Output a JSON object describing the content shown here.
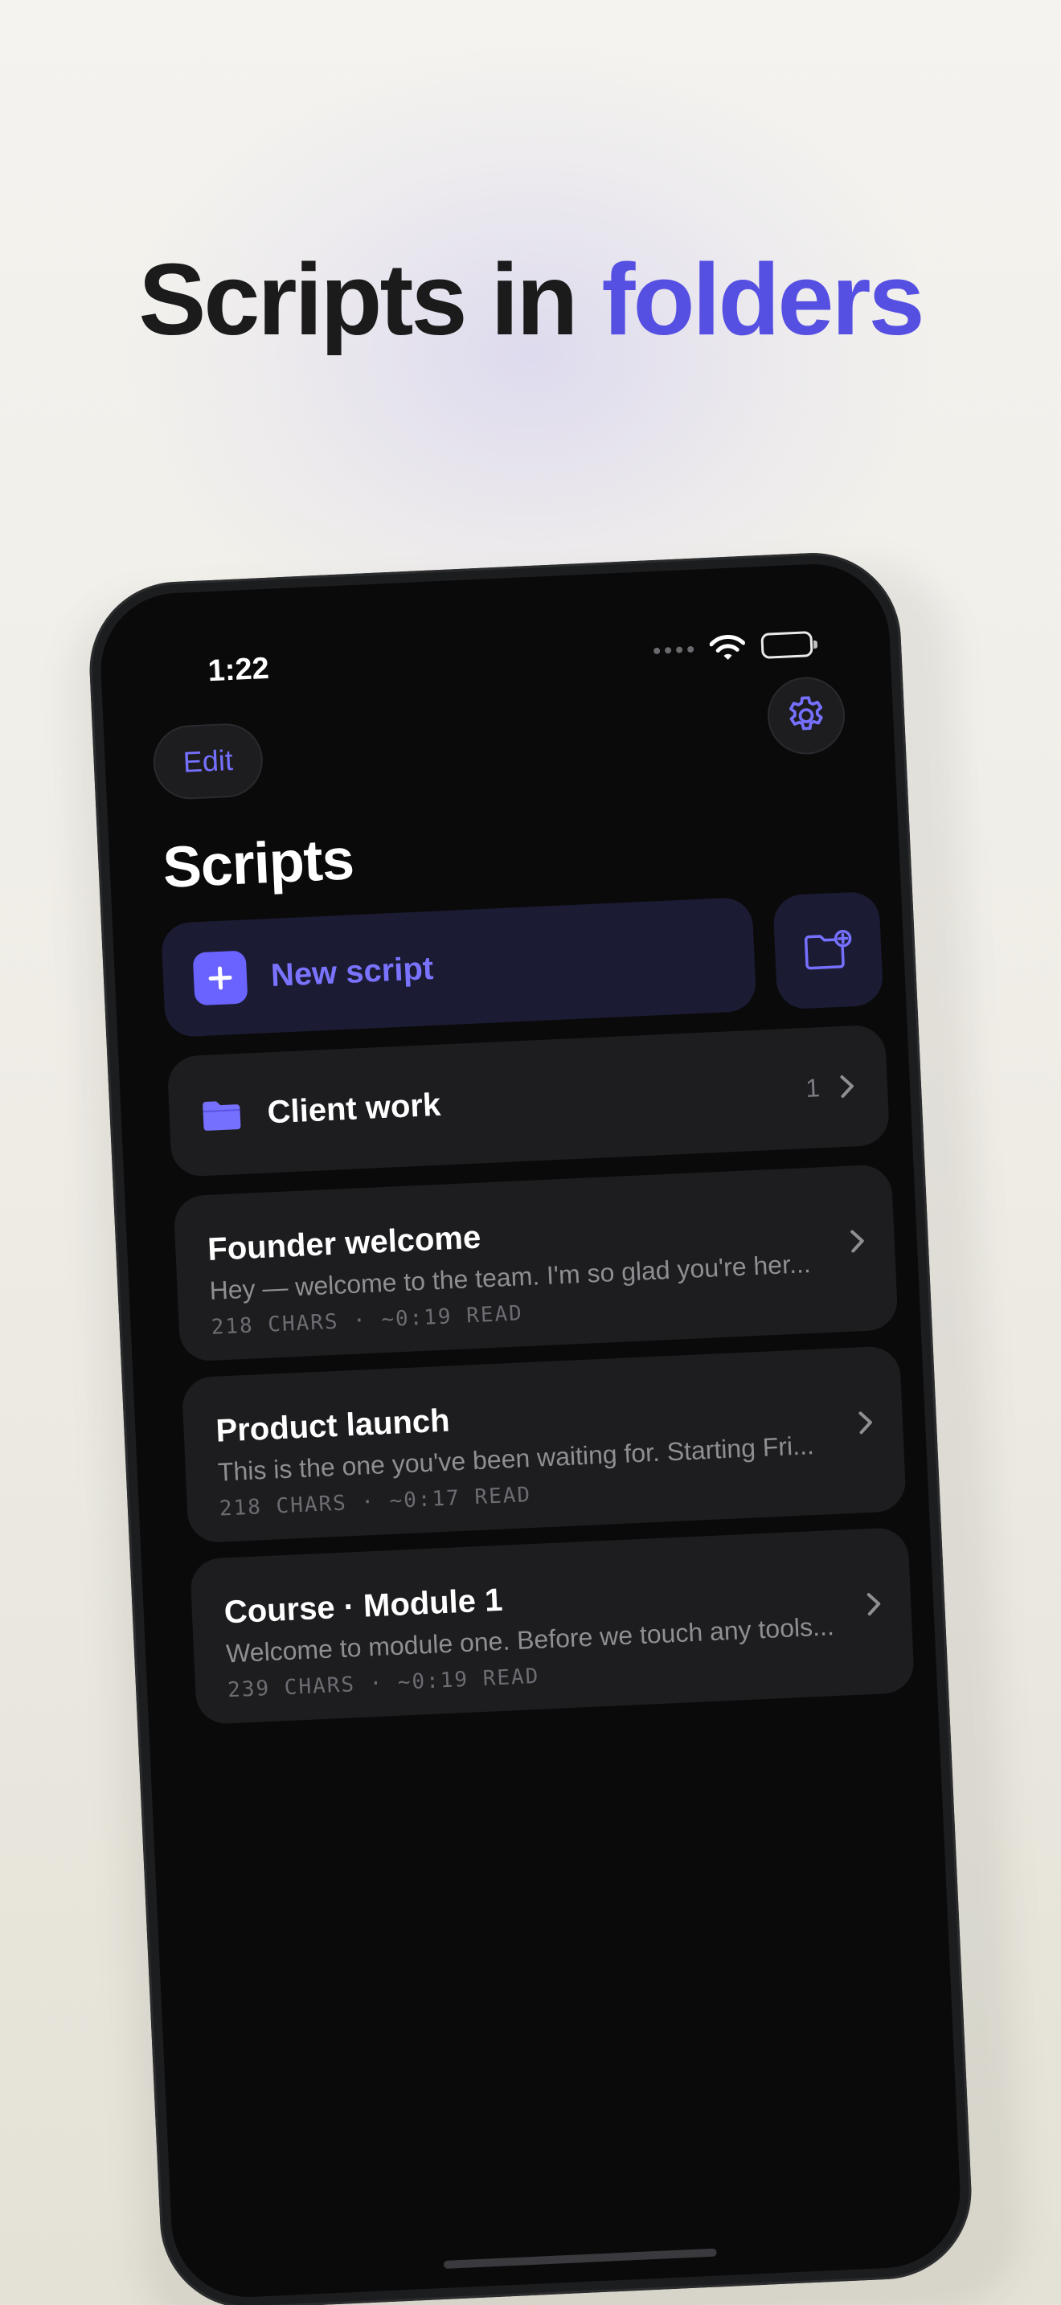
{
  "headline": {
    "part1": "Scripts in ",
    "accent": "folders"
  },
  "colors": {
    "accent": "#5650e2",
    "app_accent": "#6a63ff",
    "background": "#0a0a0b"
  },
  "status_bar": {
    "time": "1:22",
    "icons": [
      "signal-icon",
      "wifi-icon",
      "battery-icon"
    ]
  },
  "toolbar": {
    "edit_label": "Edit",
    "settings_icon": "gear-icon"
  },
  "page": {
    "title": "Scripts"
  },
  "actions": {
    "new_script_label": "New script",
    "new_folder_icon": "folder-plus-icon"
  },
  "folders": [
    {
      "name": "Client work",
      "count": "1"
    }
  ],
  "scripts": [
    {
      "title": "Founder welcome",
      "preview": "Hey — welcome to the team. I'm so glad you're her...",
      "meta": "218 CHARS · ~0:19 READ"
    },
    {
      "title": "Product launch",
      "preview": "This is the one you've been waiting for. Starting Fri...",
      "meta": "218 CHARS · ~0:17 READ"
    },
    {
      "title": "Course · Module 1",
      "preview": "Welcome to module one. Before we touch any tools...",
      "meta": "239 CHARS · ~0:19 READ"
    }
  ]
}
